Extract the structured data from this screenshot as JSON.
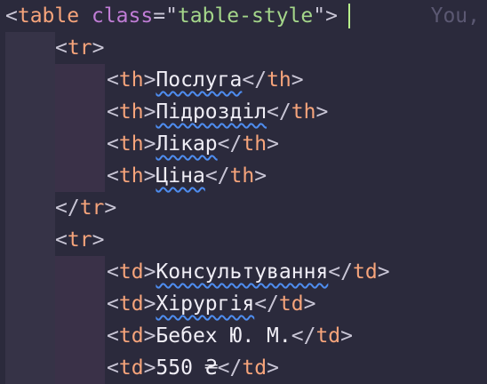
{
  "editor": {
    "colors": {
      "background": "#2b2a3c",
      "tag": "#f6a47b",
      "attribute": "#c07dd6",
      "string": "#a4d68a",
      "punctuation": "#c9c6d6",
      "text": "#f0eef6",
      "spell_squiggle": "#4e8df0",
      "cursor": "#b8f28c",
      "blame": "#5b5872"
    },
    "lines": [
      {
        "open": "<",
        "tag": "table",
        "space": " ",
        "attr": "class",
        "eq": "=\"",
        "str": "table-style",
        "close": "\">",
        "blame": "You,"
      },
      {
        "open": "<",
        "tag": "tr",
        "close": ">"
      },
      {
        "open": "<",
        "tag": "th",
        "close": ">",
        "text": "Послуга",
        "end_open": "</",
        "end_tag": "th",
        "end_close": ">"
      },
      {
        "open": "<",
        "tag": "th",
        "close": ">",
        "text": "Підрозділ",
        "end_open": "</",
        "end_tag": "th",
        "end_close": ">"
      },
      {
        "open": "<",
        "tag": "th",
        "close": ">",
        "text": "Лікар",
        "end_open": "</",
        "end_tag": "th",
        "end_close": ">"
      },
      {
        "open": "<",
        "tag": "th",
        "close": ">",
        "text": "Ціна",
        "end_open": "</",
        "end_tag": "th",
        "end_close": ">"
      },
      {
        "open": "</",
        "tag": "tr",
        "close": ">"
      },
      {
        "open": "<",
        "tag": "tr",
        "close": ">"
      },
      {
        "open": "<",
        "tag": "td",
        "close": ">",
        "text": "Консультування",
        "end_open": "</",
        "end_tag": "td",
        "end_close": ">"
      },
      {
        "open": "<",
        "tag": "td",
        "close": ">",
        "text": "Хірургія",
        "end_open": "</",
        "end_tag": "td",
        "end_close": ">"
      },
      {
        "open": "<",
        "tag": "td",
        "close": ">",
        "text": "Бебех Ю. М.",
        "end_open": "</",
        "end_tag": "td",
        "end_close": ">"
      },
      {
        "open": "<",
        "tag": "td",
        "close": ">",
        "text": "550 ₴",
        "end_open": "</",
        "end_tag": "td",
        "end_close": ">"
      }
    ]
  }
}
